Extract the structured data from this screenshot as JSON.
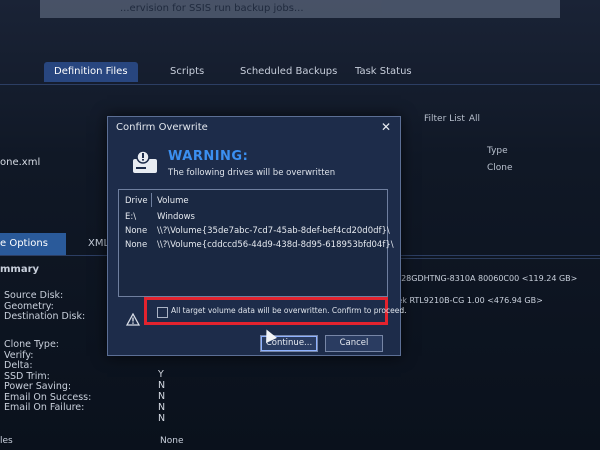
{
  "top_strip": {
    "text": "...ervision for SSIS run backup jobs..."
  },
  "tabs": [
    {
      "label": "Definition Files"
    },
    {
      "label": "Scripts"
    },
    {
      "label": "Scheduled Backups"
    },
    {
      "label": "Task Status"
    }
  ],
  "filter": {
    "label": "Filter List",
    "value": "All"
  },
  "list": {
    "column_type": "Type",
    "file_name": "one.xml",
    "type_value": "Clone"
  },
  "bottom_tabs": [
    {
      "label": "e Options"
    },
    {
      "label": "XML"
    }
  ],
  "summary": {
    "title": "mmary",
    "properties": [
      "Source Disk:",
      "Geometry:",
      "Destination Disk:",
      "",
      "Clone Type:",
      "Verify:",
      "Delta:",
      "SSD Trim:",
      "Power Saving:",
      "Email On Success:",
      "Email On Failure:"
    ],
    "values": [
      "Y",
      "N",
      "N",
      "N",
      "N"
    ],
    "source_disk_info": "128GDHTNG-8310A 80060C00 <119.24 GB>",
    "dest_disk_info": "ltek RTL9210B-CG   1.00 <476.94 GB>",
    "last_label": "les",
    "last_value": "None"
  },
  "dialog": {
    "title": "Confirm Overwrite",
    "close_symbol": "✕",
    "heading": "WARNING:",
    "subheading": "The following drives will be overwritten",
    "table_headers": {
      "drive": "Drive",
      "volume": "Volume"
    },
    "rows": [
      {
        "drive": "E:\\",
        "volume": "Windows"
      },
      {
        "drive": "None",
        "volume": "\\\\?\\Volume{35de7abc-7cd7-45ab-8def-bef4cd20d0df}\\"
      },
      {
        "drive": "None",
        "volume": "\\\\?\\Volume{cddccd56-44d9-438d-8d95-618953bfd04f}\\"
      }
    ],
    "confirm_text": "All target volume data will be overwritten. Confirm to proceed.",
    "confirm_checked": false,
    "continue_label": "Continue...",
    "cancel_label": "Cancel",
    "accent_color": "#3b8ff0",
    "highlight_color": "#e2232e"
  }
}
